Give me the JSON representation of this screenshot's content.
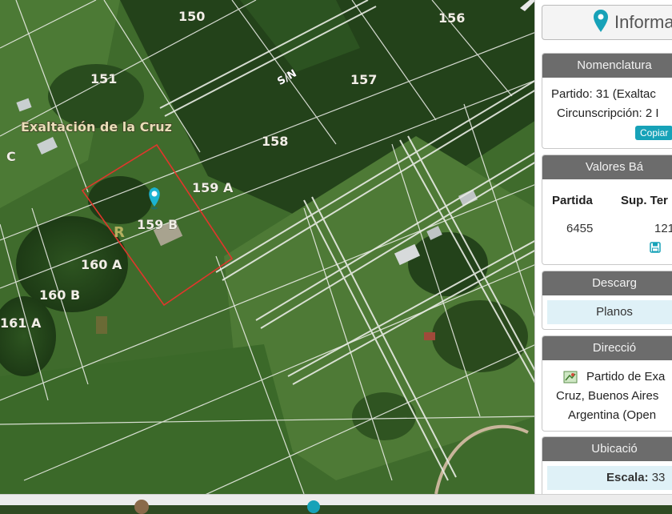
{
  "map": {
    "parcels": [
      {
        "label": "150"
      },
      {
        "label": "156"
      },
      {
        "label": "151"
      },
      {
        "label": "157"
      },
      {
        "label": "158"
      },
      {
        "label": "159 A"
      },
      {
        "label": "159 B"
      },
      {
        "label": "160 A"
      },
      {
        "label": "160 B"
      },
      {
        "label": "161 A"
      },
      {
        "label": "C"
      }
    ],
    "town_label": "Exaltación de la Cruz",
    "road_label": "S/N",
    "marker_icon": "location-pin-icon",
    "marker_color": "#1bb3d1",
    "selected_parcel_color": "#e0362c"
  },
  "panel": {
    "header": {
      "title": "Informa",
      "icon": "location-pin-icon"
    },
    "nomenclatura": {
      "heading": "Nomenclatura",
      "partido": "Partido: 31 (Exaltac",
      "circunscripcion": "Circunscripción: 2 I",
      "copy_label": "Copiar"
    },
    "valores": {
      "heading": "Valores Bá",
      "col_partida": "Partida",
      "col_sup": "Sup. Ter",
      "partida_value": "6455",
      "sup_value": "121",
      "save_icon": "floppy-disk-icon"
    },
    "descarga": {
      "heading": "Descarg",
      "planos_label": "Planos"
    },
    "direccion": {
      "heading": "Direcció",
      "line1": "Partido de Exa",
      "line2": "Cruz, Buenos Aires",
      "line3": "Argentina (Open",
      "icon": "map-icon"
    },
    "ubicacion": {
      "heading": "Ubicació",
      "scale_label": "Escala:",
      "scale_value": "33"
    }
  },
  "colors": {
    "accent": "#17a2b8",
    "card_header": "#6c6c6c",
    "strip": "#dff1f7"
  }
}
